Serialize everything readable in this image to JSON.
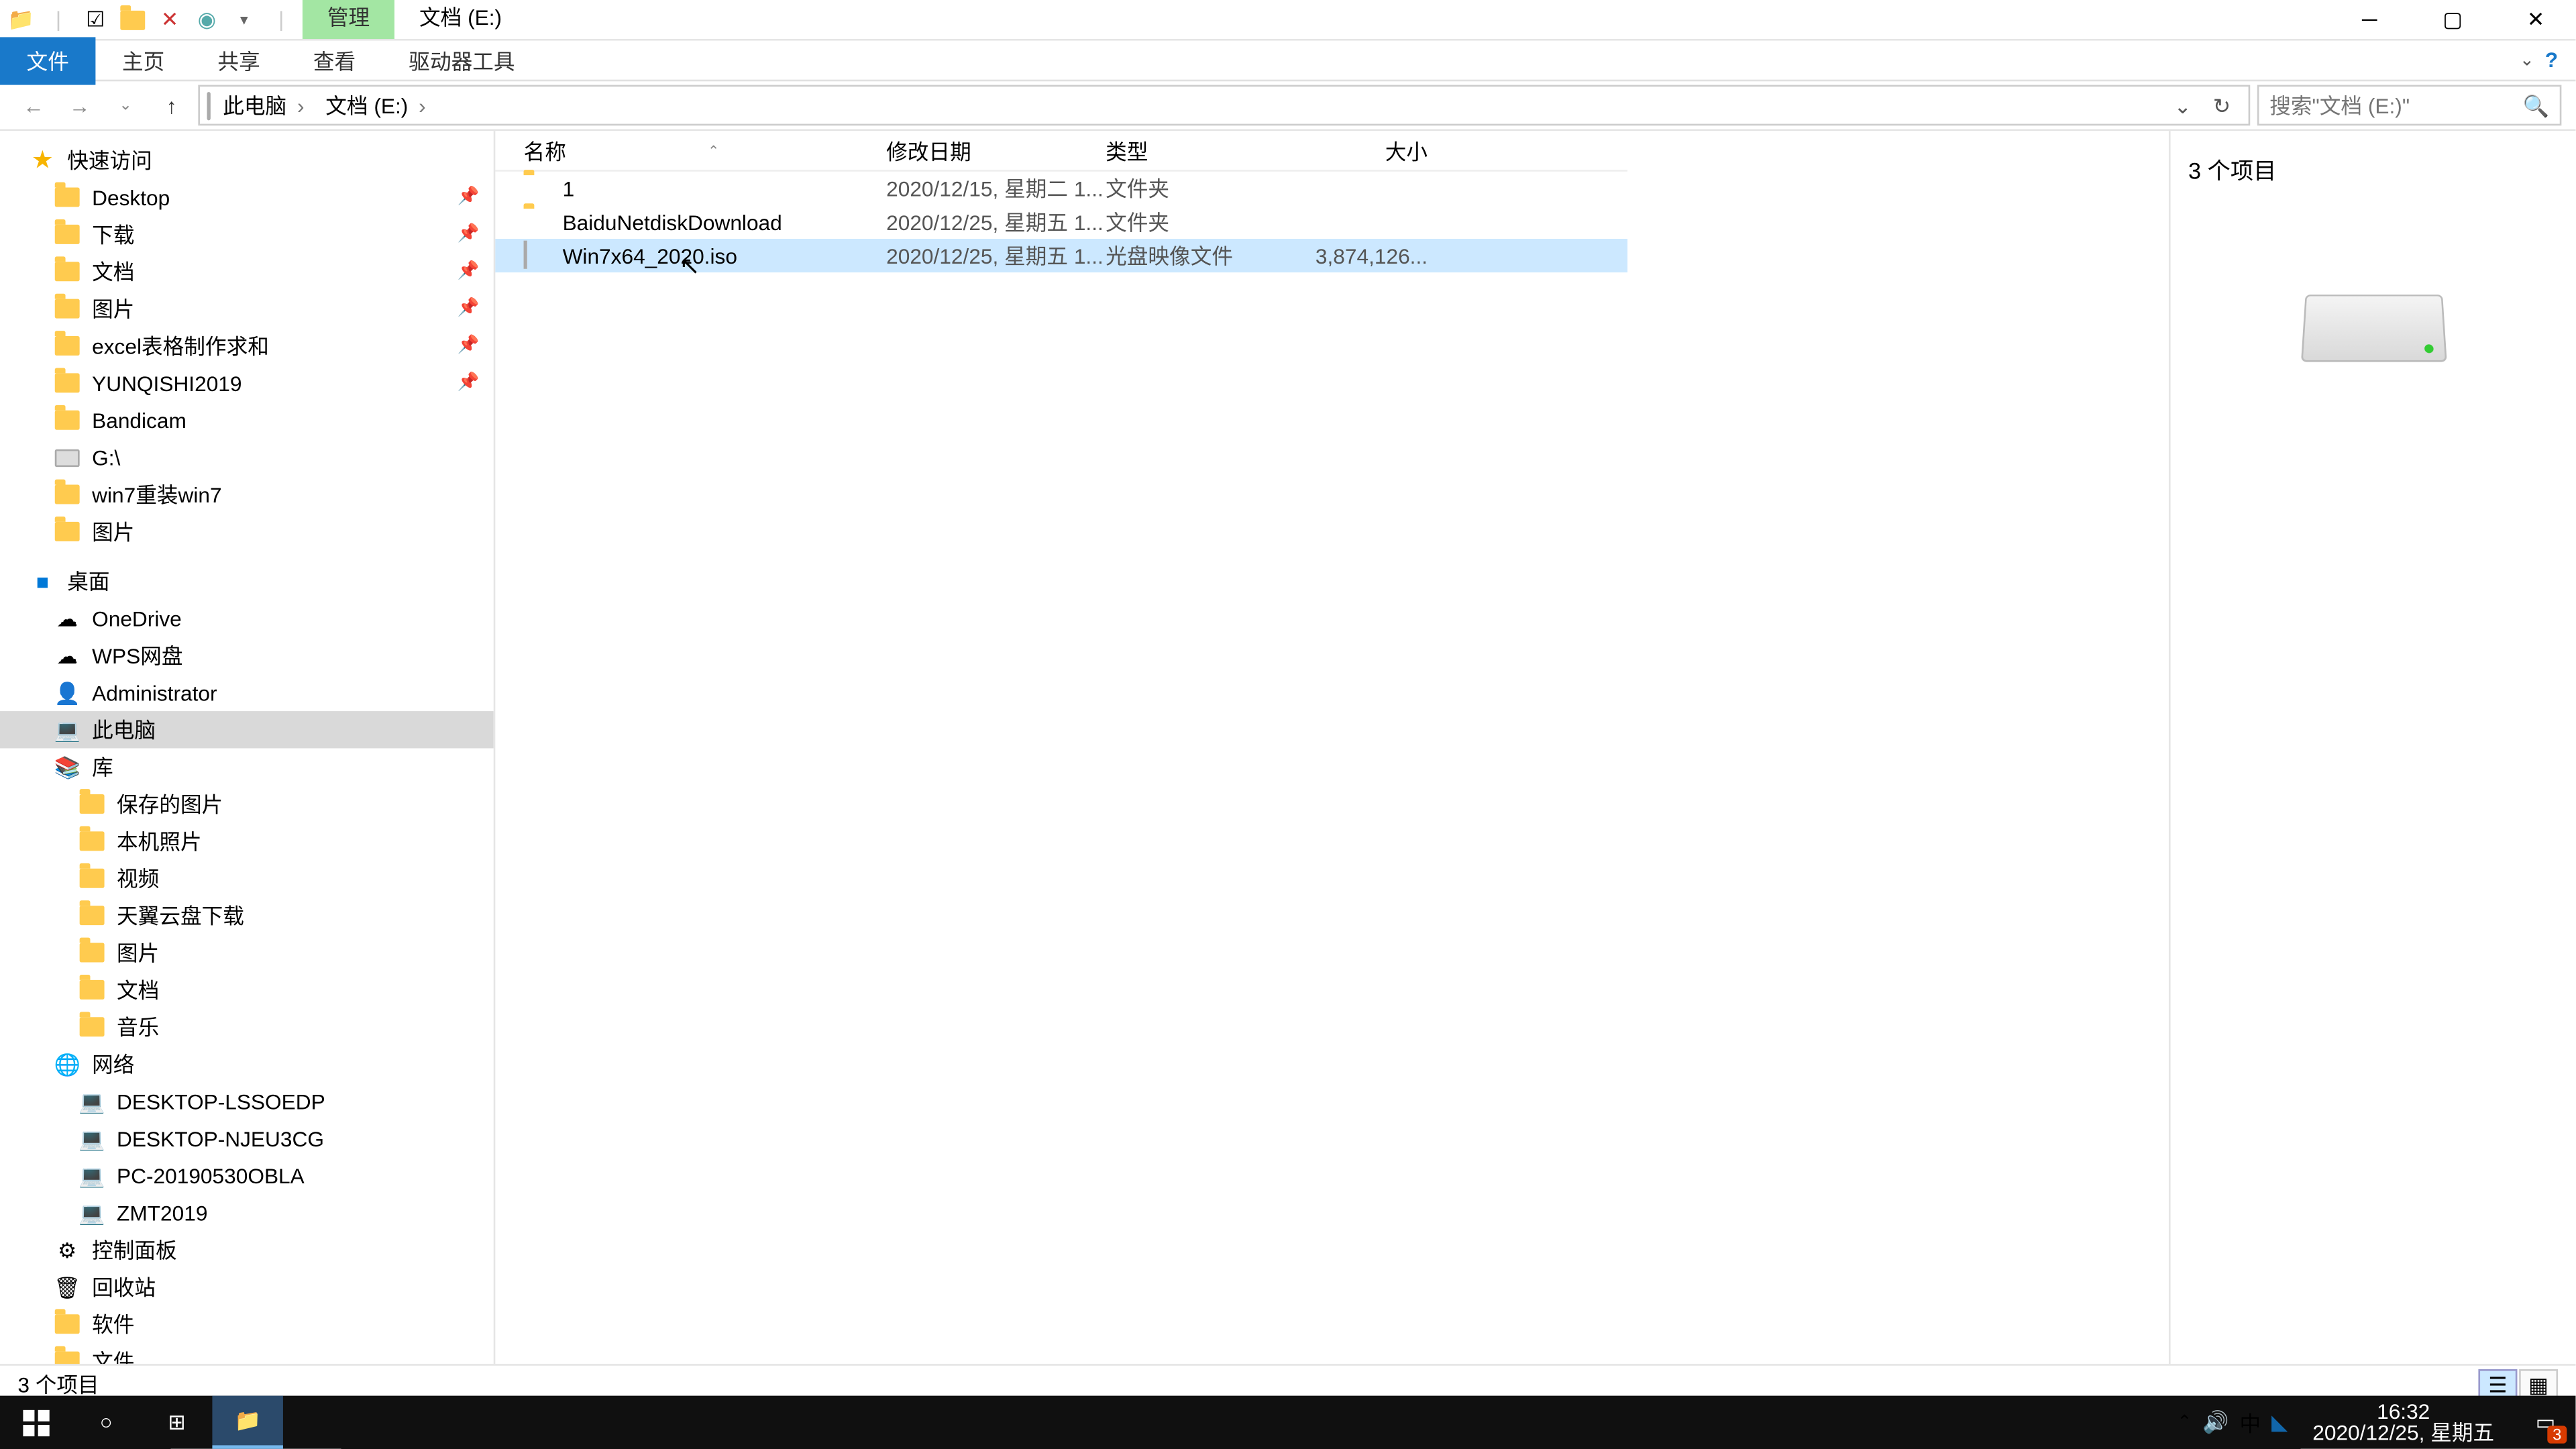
{
  "titlebar": {
    "tabs": {
      "manage": "管理",
      "location": "文档 (E:)"
    }
  },
  "ribbon": {
    "file": "文件",
    "home": "主页",
    "share": "共享",
    "view": "查看",
    "drive": "驱动器工具"
  },
  "breadcrumb": [
    "此电脑",
    "文档 (E:)"
  ],
  "search": {
    "placeholder": "搜索\"文档 (E:)\""
  },
  "tree": {
    "quick": "快速访问",
    "quick_items": [
      {
        "label": "Desktop",
        "pin": true,
        "icon": "folder"
      },
      {
        "label": "下载",
        "pin": true,
        "icon": "folder"
      },
      {
        "label": "文档",
        "pin": true,
        "icon": "folder"
      },
      {
        "label": "图片",
        "pin": true,
        "icon": "folder"
      },
      {
        "label": "excel表格制作求和",
        "pin": true,
        "icon": "folder"
      },
      {
        "label": "YUNQISHI2019",
        "pin": true,
        "icon": "folder"
      },
      {
        "label": "Bandicam",
        "pin": false,
        "icon": "folder"
      },
      {
        "label": "G:\\",
        "pin": false,
        "icon": "drive"
      },
      {
        "label": "win7重装win7",
        "pin": false,
        "icon": "folder"
      },
      {
        "label": "图片",
        "pin": false,
        "icon": "folder"
      }
    ],
    "desktop": "桌面",
    "desktop_items": [
      {
        "label": "OneDrive",
        "icon": "cloud"
      },
      {
        "label": "WPS网盘",
        "icon": "cloud"
      },
      {
        "label": "Administrator",
        "icon": "user"
      },
      {
        "label": "此电脑",
        "icon": "pc",
        "sel": true
      },
      {
        "label": "库",
        "icon": "lib"
      },
      {
        "label": "保存的图片",
        "icon": "folder",
        "d": 2
      },
      {
        "label": "本机照片",
        "icon": "folder",
        "d": 2
      },
      {
        "label": "视频",
        "icon": "folder",
        "d": 2
      },
      {
        "label": "天翼云盘下载",
        "icon": "folder",
        "d": 2
      },
      {
        "label": "图片",
        "icon": "folder",
        "d": 2
      },
      {
        "label": "文档",
        "icon": "folder",
        "d": 2
      },
      {
        "label": "音乐",
        "icon": "folder",
        "d": 2
      },
      {
        "label": "网络",
        "icon": "net"
      },
      {
        "label": "DESKTOP-LSSOEDP",
        "icon": "pc",
        "d": 2
      },
      {
        "label": "DESKTOP-NJEU3CG",
        "icon": "pc",
        "d": 2
      },
      {
        "label": "PC-20190530OBLA",
        "icon": "pc",
        "d": 2
      },
      {
        "label": "ZMT2019",
        "icon": "pc",
        "d": 2
      },
      {
        "label": "控制面板",
        "icon": "cp"
      },
      {
        "label": "回收站",
        "icon": "bin"
      },
      {
        "label": "软件",
        "icon": "folder"
      },
      {
        "label": "文件",
        "icon": "folder"
      }
    ]
  },
  "columns": {
    "name": "名称",
    "date": "修改日期",
    "type": "类型",
    "size": "大小"
  },
  "rows": [
    {
      "name": "1",
      "date": "2020/12/15, 星期二 1...",
      "type": "文件夹",
      "size": "",
      "icon": "folder"
    },
    {
      "name": "BaiduNetdiskDownload",
      "date": "2020/12/25, 星期五 1...",
      "type": "文件夹",
      "size": "",
      "icon": "folder"
    },
    {
      "name": "Win7x64_2020.iso",
      "date": "2020/12/25, 星期五 1...",
      "type": "光盘映像文件",
      "size": "3,874,126...",
      "icon": "file",
      "sel": true
    }
  ],
  "preview": {
    "count": "3 个项目"
  },
  "status": {
    "text": "3 个项目"
  },
  "taskbar": {
    "time": "16:32",
    "date": "2020/12/25, 星期五",
    "ime": "中",
    "badge": "3"
  }
}
